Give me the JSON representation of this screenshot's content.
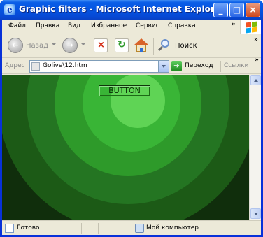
{
  "window": {
    "title": "Graphic filters - Microsoft Internet Explorer",
    "controls": [
      "minimize",
      "maximize",
      "close"
    ]
  },
  "menu": {
    "items": [
      "Файл",
      "Правка",
      "Вид",
      "Избранное",
      "Сервис",
      "Справка"
    ],
    "overflow": "»"
  },
  "toolbar": {
    "back_label": "Назад",
    "search_label": "Поиск",
    "overflow": "»",
    "icons": [
      "back-arrow",
      "forward-arrow",
      "stop",
      "refresh",
      "home",
      "search"
    ]
  },
  "address": {
    "label": "Адрес",
    "value": "Golive\\12.htm",
    "go_label": "Переход",
    "links_label": "Ссылки",
    "overflow": "»"
  },
  "page": {
    "button_label": "BUTTON",
    "colors": {
      "background": "#102e0c",
      "ring_outer": "#1c5a16",
      "ring_2": "#247522",
      "ring_3": "#2e9a2a",
      "ring_4": "#39b536",
      "center": "#5fd455"
    }
  },
  "status": {
    "text": "Готово",
    "zone": "Мой компьютер"
  }
}
